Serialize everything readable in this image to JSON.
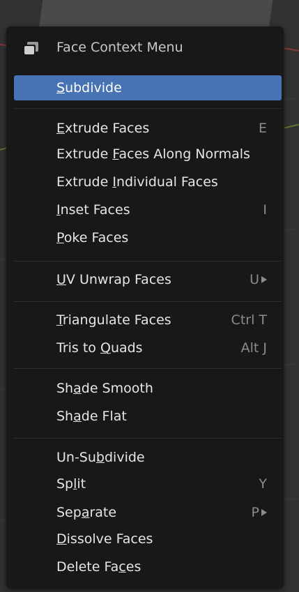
{
  "menu": {
    "header": {
      "title": "Face Context Menu",
      "icon": "cube-faces-icon"
    },
    "items": [
      {
        "label": "Subdivide",
        "u": "S",
        "shortcut": "",
        "submenu": false,
        "active": true
      },
      {
        "label": "Extrude Faces",
        "u": "E",
        "shortcut": "E",
        "submenu": false,
        "active": false
      },
      {
        "label": "Extrude Faces Along Normals",
        "u": "F",
        "shortcut": "",
        "submenu": false,
        "active": false
      },
      {
        "label": "Extrude Individual Faces",
        "u": "I",
        "shortcut": "",
        "submenu": false,
        "active": false
      },
      {
        "label": "Inset Faces",
        "u": "I",
        "shortcut": "I",
        "submenu": false,
        "active": false
      },
      {
        "label": "Poke Faces",
        "u": "P",
        "shortcut": "",
        "submenu": false,
        "active": false
      },
      {
        "label": "UV Unwrap Faces",
        "u": "U",
        "shortcut": "U",
        "submenu": true,
        "active": false
      },
      {
        "label": "Triangulate Faces",
        "u": "T",
        "shortcut": "Ctrl T",
        "submenu": false,
        "active": false
      },
      {
        "label": "Tris to Quads",
        "u": "Q",
        "shortcut": "Alt J",
        "submenu": false,
        "active": false
      },
      {
        "label": "Shade Smooth",
        "u": "a",
        "shortcut": "",
        "submenu": false,
        "active": false
      },
      {
        "label": "Shade Flat",
        "u": "a",
        "shortcut": "",
        "submenu": false,
        "active": false
      },
      {
        "label": "Un-Subdivide",
        "u": "b",
        "shortcut": "",
        "submenu": false,
        "active": false
      },
      {
        "label": "Split",
        "u": "l",
        "shortcut": "Y",
        "submenu": false,
        "active": false
      },
      {
        "label": "Separate",
        "u": "a",
        "shortcut": "P",
        "submenu": true,
        "active": false
      },
      {
        "label": "Dissolve Faces",
        "u": "D",
        "shortcut": "",
        "submenu": false,
        "active": false
      },
      {
        "label": "Delete Faces",
        "u": "c",
        "shortcut": "",
        "submenu": false,
        "active": false
      }
    ]
  },
  "colors": {
    "highlight": "#4772b3",
    "menu_bg": "#181818",
    "text": "#e6e6e6",
    "shortcut_text": "#8c8c8c"
  }
}
